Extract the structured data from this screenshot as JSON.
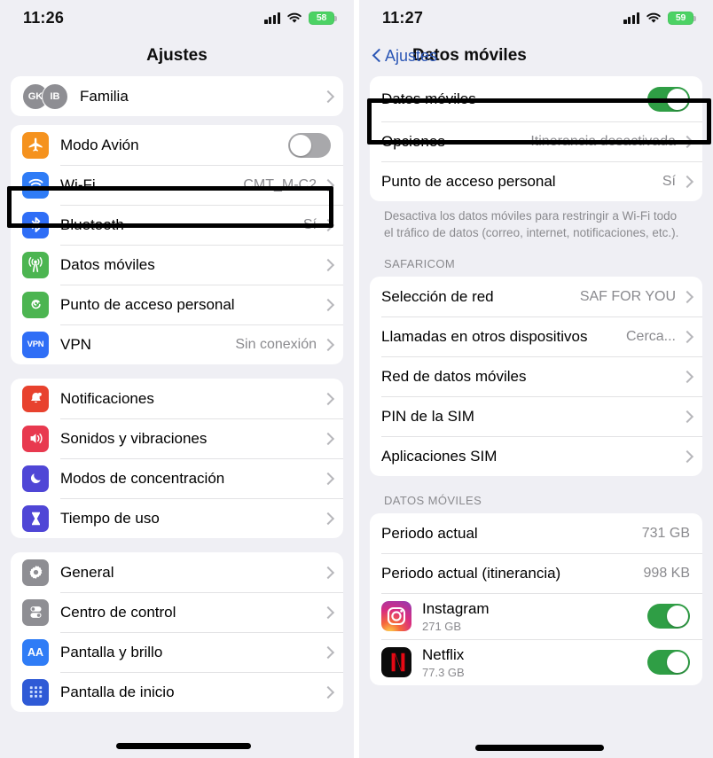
{
  "left": {
    "status": {
      "time": "11:26",
      "battery": "58"
    },
    "nav": {
      "title": "Ajustes"
    },
    "groups": [
      {
        "rows": [
          {
            "icon": "family-avatars",
            "label": "Familia",
            "value": "",
            "accessory": "chevron",
            "avatars": [
              "GK",
              "IB"
            ]
          }
        ]
      },
      {
        "rows": [
          {
            "icon": "airplane-icon",
            "label": "Modo Avión",
            "value": "",
            "accessory": "toggle-off"
          },
          {
            "icon": "wifi-icon",
            "label": "Wi-Fi",
            "value": "CMT_M-C2",
            "accessory": "chevron"
          },
          {
            "icon": "bluetooth-icon",
            "label": "Bluetooth",
            "value": "Sí",
            "accessory": "chevron"
          },
          {
            "icon": "cellular-icon",
            "label": "Datos móviles",
            "value": "",
            "accessory": "chevron"
          },
          {
            "icon": "hotspot-icon",
            "label": "Punto de acceso personal",
            "value": "",
            "accessory": "chevron"
          },
          {
            "icon": "vpn-icon",
            "label": "VPN",
            "value": "Sin conexión",
            "accessory": "chevron"
          }
        ]
      },
      {
        "rows": [
          {
            "icon": "notifications-icon",
            "label": "Notificaciones",
            "value": "",
            "accessory": "chevron"
          },
          {
            "icon": "sounds-icon",
            "label": "Sonidos y vibraciones",
            "value": "",
            "accessory": "chevron"
          },
          {
            "icon": "focus-icon",
            "label": "Modos de concentración",
            "value": "",
            "accessory": "chevron"
          },
          {
            "icon": "screentime-icon",
            "label": "Tiempo de uso",
            "value": "",
            "accessory": "chevron"
          }
        ]
      },
      {
        "rows": [
          {
            "icon": "gear-icon",
            "label": "General",
            "value": "",
            "accessory": "chevron"
          },
          {
            "icon": "control-center-icon",
            "label": "Centro de control",
            "value": "",
            "accessory": "chevron"
          },
          {
            "icon": "display-brightness-icon",
            "label": "Pantalla y brillo",
            "value": "",
            "accessory": "chevron"
          },
          {
            "icon": "home-screen-icon",
            "label": "Pantalla de inicio",
            "value": "",
            "accessory": "chevron"
          }
        ]
      }
    ]
  },
  "right": {
    "status": {
      "time": "11:27",
      "battery": "59"
    },
    "nav": {
      "back_label": "Ajustes",
      "title": "Datos móviles"
    },
    "group1": {
      "rows": [
        {
          "label": "Datos móviles",
          "value": "",
          "accessory": "toggle-on"
        },
        {
          "label": "Opciones",
          "value": "Itinerancia desactivada",
          "accessory": "chevron"
        },
        {
          "label": "Punto de acceso personal",
          "value": "Sí",
          "accessory": "chevron"
        }
      ],
      "footer": "Desactiva los datos móviles para restringir a Wi-Fi todo el tráfico de datos (correo, internet, notificaciones, etc.)."
    },
    "group2": {
      "header": "SAFARICOM",
      "rows": [
        {
          "label": "Selección de red",
          "value": "SAF FOR YOU",
          "accessory": "chevron"
        },
        {
          "label": "Llamadas en otros dispositivos",
          "value": "Cerca...",
          "accessory": "chevron"
        },
        {
          "label": "Red de datos móviles",
          "value": "",
          "accessory": "chevron"
        },
        {
          "label": "PIN de la SIM",
          "value": "",
          "accessory": "chevron"
        },
        {
          "label": "Aplicaciones SIM",
          "value": "",
          "accessory": "chevron"
        }
      ]
    },
    "group3": {
      "header": "DATOS MÓVILES",
      "rows": [
        {
          "label": "Periodo actual",
          "value": "731 GB"
        },
        {
          "label": "Periodo actual (itinerancia)",
          "value": "998 KB"
        }
      ],
      "apps": [
        {
          "icon": "instagram-icon",
          "name": "Instagram",
          "usage": "271 GB",
          "accessory": "toggle-on"
        },
        {
          "icon": "netflix-icon",
          "name": "Netflix",
          "usage": "77.3 GB",
          "accessory": "toggle-on"
        }
      ]
    }
  },
  "colors": {
    "accent_blue": "#2b56b5",
    "toggle_on": "#2f9e45",
    "toggle_off": "#a8a8ab",
    "battery_green": "#4cd264",
    "highlight_box": "#000000",
    "page_bg": "#efeff4",
    "card_bg": "#ffffff",
    "secondary_text": "#8a8a8e"
  }
}
